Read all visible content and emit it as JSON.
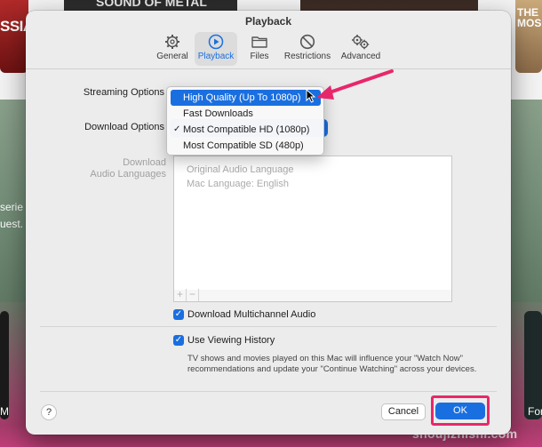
{
  "background": {
    "tiles": [
      "SSIA",
      "SOUND OF METAL",
      "",
      "THE MOSCO"
    ],
    "hero_text_1": "serie",
    "hero_text_2": "uest.",
    "bottom_left": "M",
    "bottom_right": "For",
    "watermark": "shoujizhishi.com"
  },
  "window": {
    "title": "Playback",
    "tabs": [
      {
        "label": "General",
        "icon": "gear-icon"
      },
      {
        "label": "Playback",
        "icon": "play-icon"
      },
      {
        "label": "Files",
        "icon": "folder-icon"
      },
      {
        "label": "Restrictions",
        "icon": "restriction-icon"
      },
      {
        "label": "Advanced",
        "icon": "advanced-gears-icon"
      }
    ],
    "active_tab": "Playback",
    "streaming_label": "Streaming Options",
    "download_label": "Download Options",
    "download_audio_label_1": "Download",
    "download_audio_label_2": "Audio Languages",
    "audio_languages": [
      "Original Audio Language",
      "Mac Language: English"
    ],
    "list_add": "+",
    "list_remove": "−",
    "multichannel_label": "Download Multichannel Audio",
    "multichannel_checked": true,
    "history_label": "Use Viewing History",
    "history_checked": true,
    "history_description": "TV shows and movies played on this Mac will influence your \"Watch Now\" recommendations and update your \"Continue Watching\" across your devices.",
    "help_label": "?",
    "cancel_label": "Cancel",
    "ok_label": "OK"
  },
  "menu": {
    "items": [
      {
        "label": "High Quality (Up To 1080p)",
        "highlighted": true,
        "checked": false
      },
      {
        "label": "Fast Downloads",
        "highlighted": false,
        "checked": false
      },
      {
        "label": "Most Compatible HD (1080p)",
        "highlighted": false,
        "checked": true
      },
      {
        "label": "Most Compatible SD (480p)",
        "highlighted": false,
        "checked": false
      }
    ],
    "check_glyph": "✓"
  },
  "colors": {
    "accent": "#1a6fe0",
    "highlight_annotation": "#e8276a"
  }
}
